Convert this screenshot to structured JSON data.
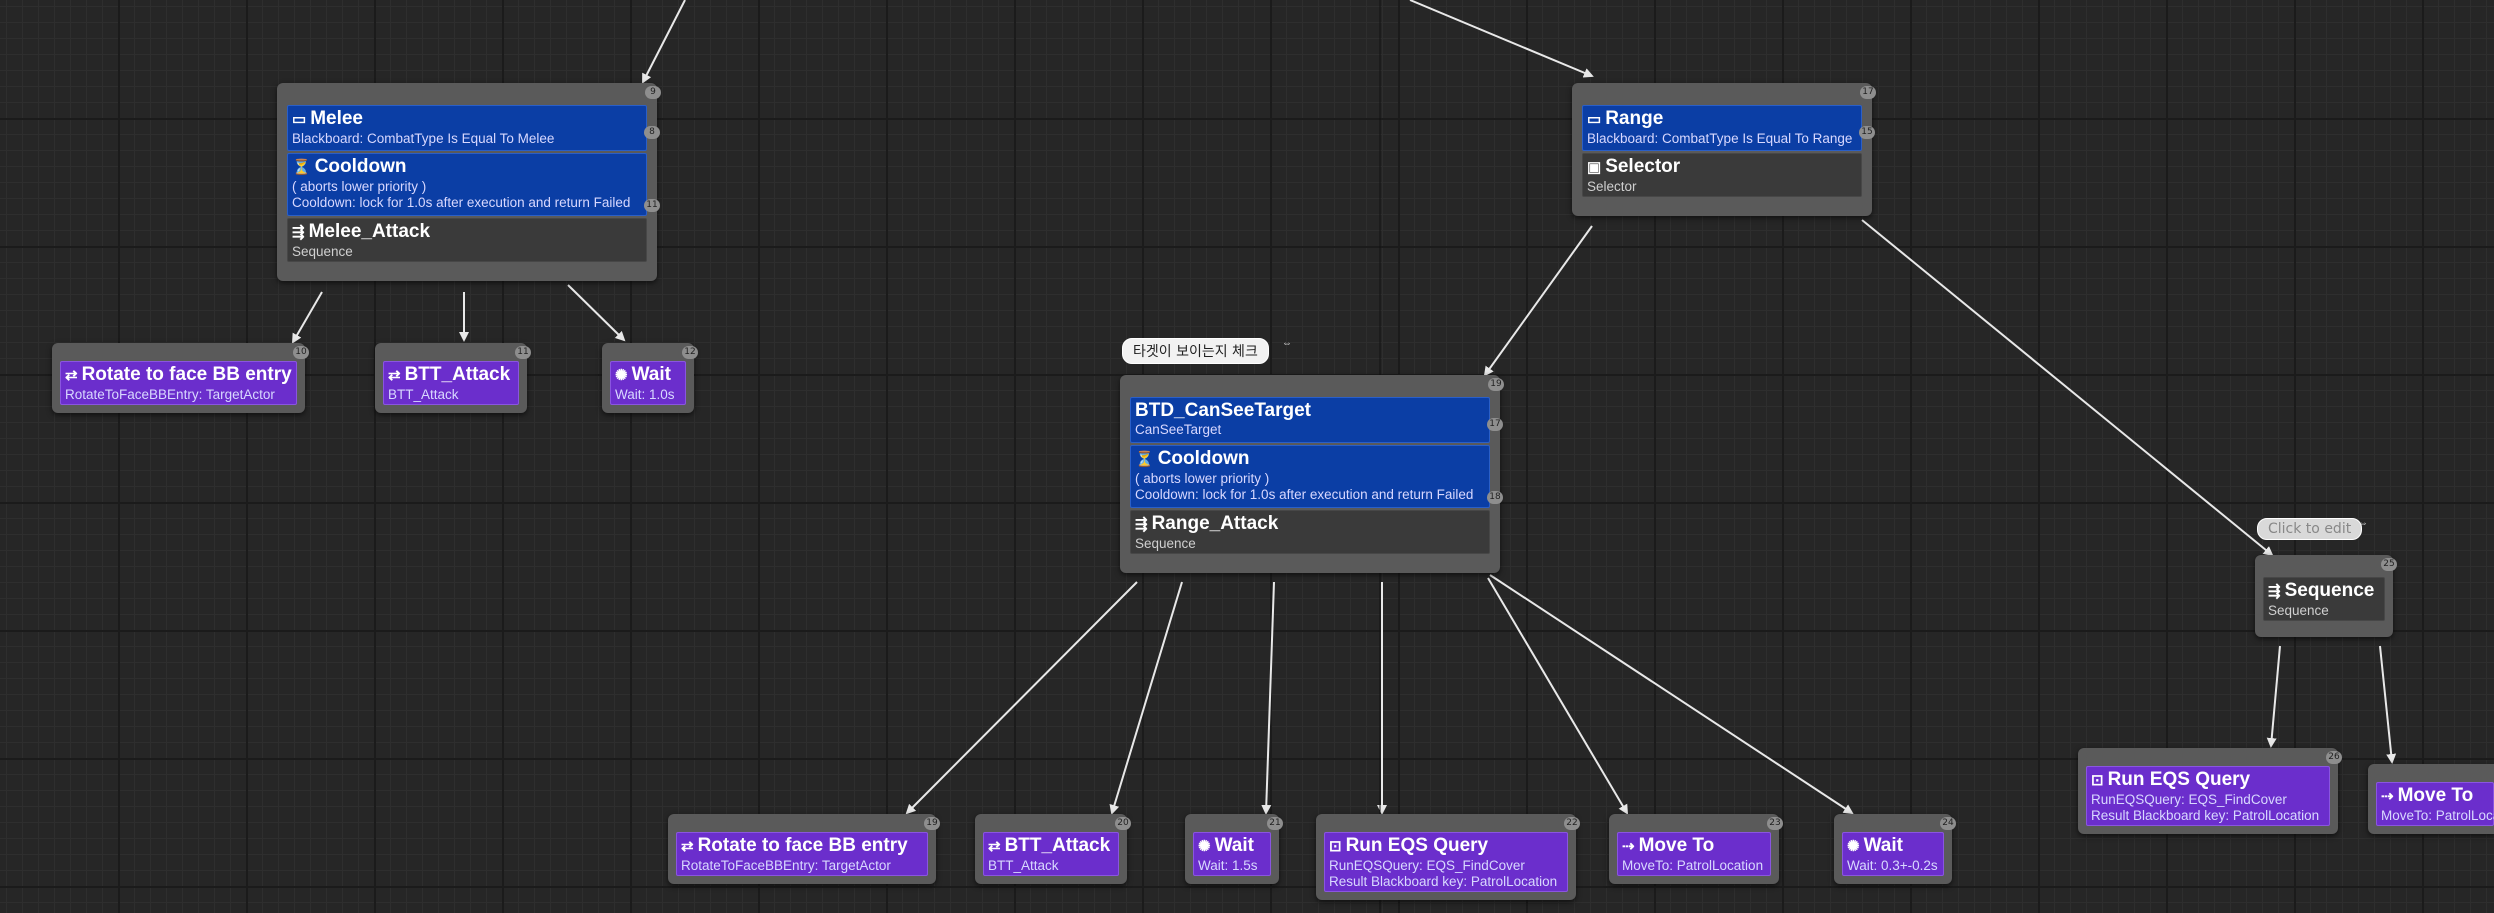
{
  "comments": {
    "range_comment": "타겟이 보이는지 체크",
    "sequence_comment": "Click to edit"
  },
  "melee": {
    "decorator_title": "Melee",
    "decorator_sub": "Blackboard: CombatType Is Equal To Melee",
    "cooldown_title": "Cooldown",
    "cooldown_sub1": "( aborts lower priority )",
    "cooldown_sub2": "Cooldown: lock for 1.0s after execution and return Failed",
    "composite_title": "Melee_Attack",
    "composite_sub": "Sequence",
    "index_top": "9",
    "index_decorator": "8",
    "index_cooldown": "11"
  },
  "range": {
    "decorator_title": "Range",
    "decorator_sub": "Blackboard: CombatType Is Equal To Range",
    "composite_title": "Selector",
    "composite_sub": "Selector",
    "index_top": "17",
    "index_decorator": "15"
  },
  "see_target": {
    "decorator_title": "BTD_CanSeeTarget",
    "decorator_sub": "CanSeeTarget",
    "cooldown_title": "Cooldown",
    "cooldown_sub1": "( aborts lower priority )",
    "cooldown_sub2": "Cooldown: lock for 1.0s after execution and return Failed",
    "composite_title": "Range_Attack",
    "composite_sub": "Sequence",
    "index_top": "19",
    "index_decorator": "17",
    "index_cooldown": "18"
  },
  "sequence": {
    "title": "Sequence",
    "sub": "Sequence",
    "index": "25"
  },
  "tasks": {
    "melee_rotate": {
      "title": "Rotate to face BB entry",
      "sub": "RotateToFaceBBEntry: TargetActor",
      "index": "10"
    },
    "melee_attack": {
      "title": "BTT_Attack",
      "sub": "BTT_Attack",
      "index": "11"
    },
    "melee_wait": {
      "title": "Wait",
      "sub": "Wait: 1.0s",
      "index": "12"
    },
    "range_rotate": {
      "title": "Rotate to face BB entry",
      "sub": "RotateToFaceBBEntry: TargetActor",
      "index": "19"
    },
    "range_attack": {
      "title": "BTT_Attack",
      "sub": "BTT_Attack",
      "index": "20"
    },
    "range_wait": {
      "title": "Wait",
      "sub": "Wait: 1.5s",
      "index": "21"
    },
    "range_eqs": {
      "title": "Run EQS Query",
      "sub1": "RunEQSQuery: EQS_FindCover",
      "sub2": "Result Blackboard key: PatrolLocation",
      "index": "22"
    },
    "range_move": {
      "title": "Move To",
      "sub": "MoveTo: PatrolLocation",
      "index": "23"
    },
    "range_wait2": {
      "title": "Wait",
      "sub": "Wait: 0.3+-0.2s",
      "index": "24"
    },
    "seq_eqs": {
      "title": "Run EQS Query",
      "sub1": "RunEQSQuery: EQS_FindCover",
      "sub2": "Result Blackboard key: PatrolLocation",
      "index": "26"
    },
    "seq_move": {
      "title": "Move To",
      "sub": "MoveTo: PatrolLocation"
    }
  },
  "icons": {
    "decorator": "blackboard-decorator-icon",
    "cooldown": "cooldown-icon",
    "sequence": "sequence-icon",
    "selector": "selector-icon",
    "rotate": "rotate-task-icon",
    "wait": "wait-icon",
    "eqs": "eqs-query-icon",
    "move": "move-to-icon"
  },
  "colors": {
    "decorator": "#0b3ea5",
    "task": "#6b2ecc",
    "composite": "#3a3a3a",
    "wire": "#e8e8e8"
  }
}
